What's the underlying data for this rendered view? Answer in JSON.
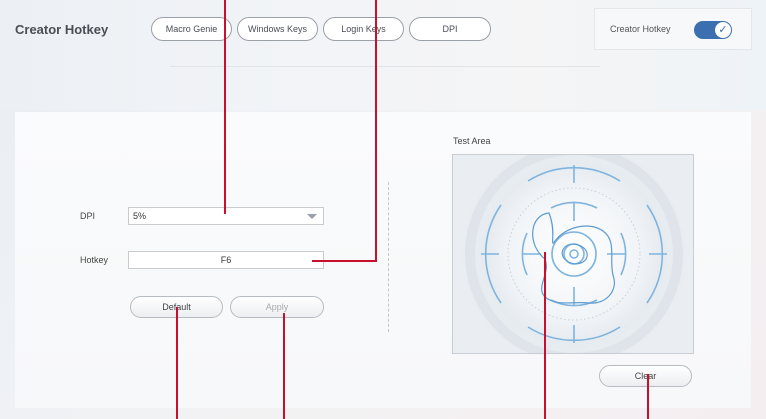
{
  "app": {
    "title": "Creator Hotkey"
  },
  "tabs": [
    {
      "label": "Macro Genie"
    },
    {
      "label": "Windows Keys"
    },
    {
      "label": "Login Keys"
    },
    {
      "label": "DPI"
    }
  ],
  "header_toggle": {
    "label": "Creator Hotkey",
    "state": "on",
    "check_glyph": "✓"
  },
  "form": {
    "dpi_label": "DPI",
    "dpi_value": "5%",
    "hotkey_label": "Hotkey",
    "hotkey_value": "F6",
    "default_button": "Default",
    "apply_button": "Apply"
  },
  "test_area": {
    "title": "Test Area",
    "clear_button": "Clear"
  },
  "colors": {
    "accent": "#3b6fb0",
    "annotation": "#c8102e",
    "reticle": "#7fb4de",
    "trace": "#5d9bd1"
  }
}
